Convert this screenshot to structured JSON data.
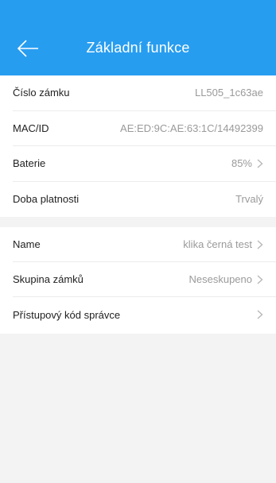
{
  "header": {
    "title": "Základní funkce",
    "background": "#279df0"
  },
  "sections": [
    {
      "rows": [
        {
          "label": "Číslo zámku",
          "value": "LL505_1c63ae"
        },
        {
          "label": "MAC/ID",
          "value": "AE:ED:9C:AE:63:1C/14492399"
        },
        {
          "label": "Baterie",
          "value": "85%"
        },
        {
          "label": "Doba platnosti",
          "value": "Trvalý"
        }
      ]
    },
    {
      "rows": [
        {
          "label": "Name",
          "value": "klika černá test"
        },
        {
          "label": "Skupina zámků",
          "value": "Neseskupeno"
        },
        {
          "label": "Přístupový kód správce",
          "value": ""
        }
      ]
    }
  ],
  "icons": {
    "back": "arrow-left-icon",
    "chevron": "chevron-right-icon"
  }
}
